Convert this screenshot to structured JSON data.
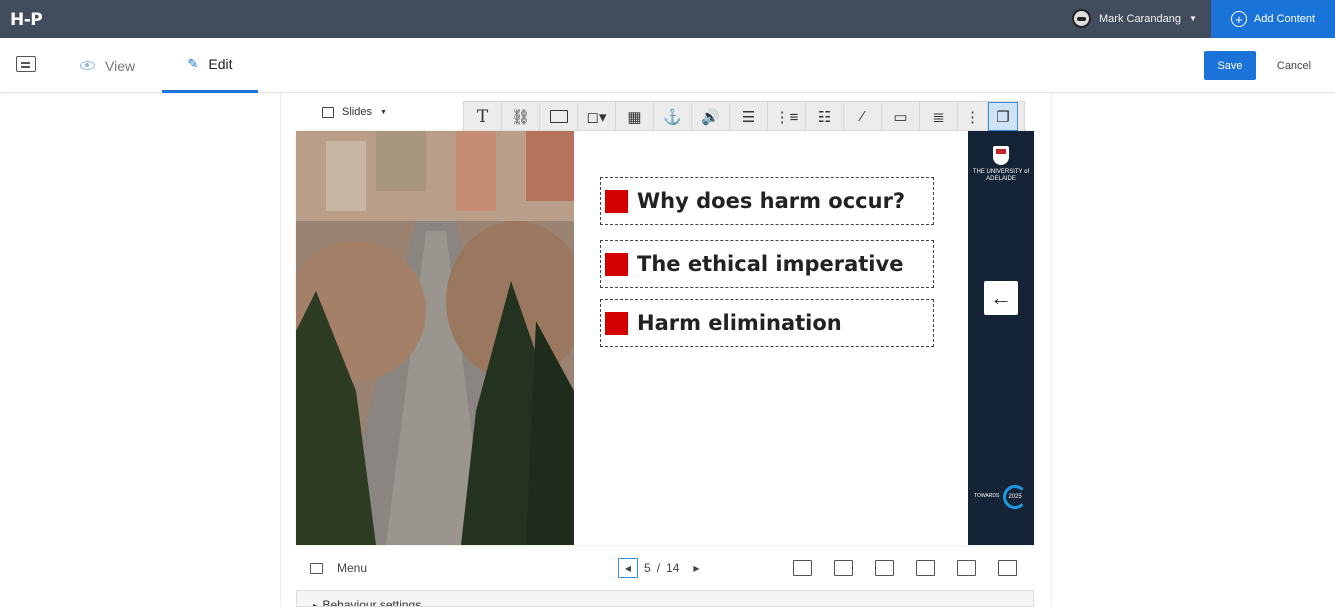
{
  "topbar": {
    "logo": "H-P",
    "user_name": "Mark Carandang",
    "add_content_label": "Add Content"
  },
  "nav": {
    "tabs": [
      {
        "label": "View",
        "icon": "eye-icon",
        "active": false
      },
      {
        "label": "Edit",
        "icon": "pencil-icon",
        "active": true
      }
    ],
    "save_label": "Save",
    "cancel_label": "Cancel"
  },
  "editor": {
    "mode_label": "Slides",
    "toolbar": [
      {
        "name": "text-tool",
        "glyph": "T"
      },
      {
        "name": "link-tool",
        "glyph": "🔗"
      },
      {
        "name": "image-tool",
        "glyph": "🖼"
      },
      {
        "name": "shapes-tool",
        "glyph": "⬚"
      },
      {
        "name": "video-tool",
        "glyph": "🎞"
      },
      {
        "name": "anchor-tool",
        "glyph": "⚓"
      },
      {
        "name": "audio-tool",
        "glyph": "🔊"
      },
      {
        "name": "fill-in-blanks-tool",
        "glyph": "☰"
      },
      {
        "name": "single-choice-tool",
        "glyph": "☷"
      },
      {
        "name": "multiple-choice-tool",
        "glyph": "☰"
      },
      {
        "name": "true-false-tool",
        "glyph": "⁄"
      },
      {
        "name": "drag-text-tool",
        "glyph": "▭"
      },
      {
        "name": "summary-tool",
        "glyph": "≡"
      },
      {
        "name": "more-tool",
        "glyph": "⋮"
      },
      {
        "name": "paste-tool",
        "glyph": "▢"
      }
    ]
  },
  "slide": {
    "bullets": [
      "Why does harm occur?",
      "The ethical imperative",
      "Harm elimination"
    ],
    "university_name": "THE UNIVERSITY of ADELAIDE",
    "footer_text": "TOWARDS",
    "footer_year": "2025",
    "accent_color": "#d40000",
    "band_color": "#142336"
  },
  "bottom": {
    "menu_label": "Menu",
    "current_slide": "5",
    "separator": "/",
    "total_slides": "14",
    "behaviour_label": "Behaviour settings"
  }
}
